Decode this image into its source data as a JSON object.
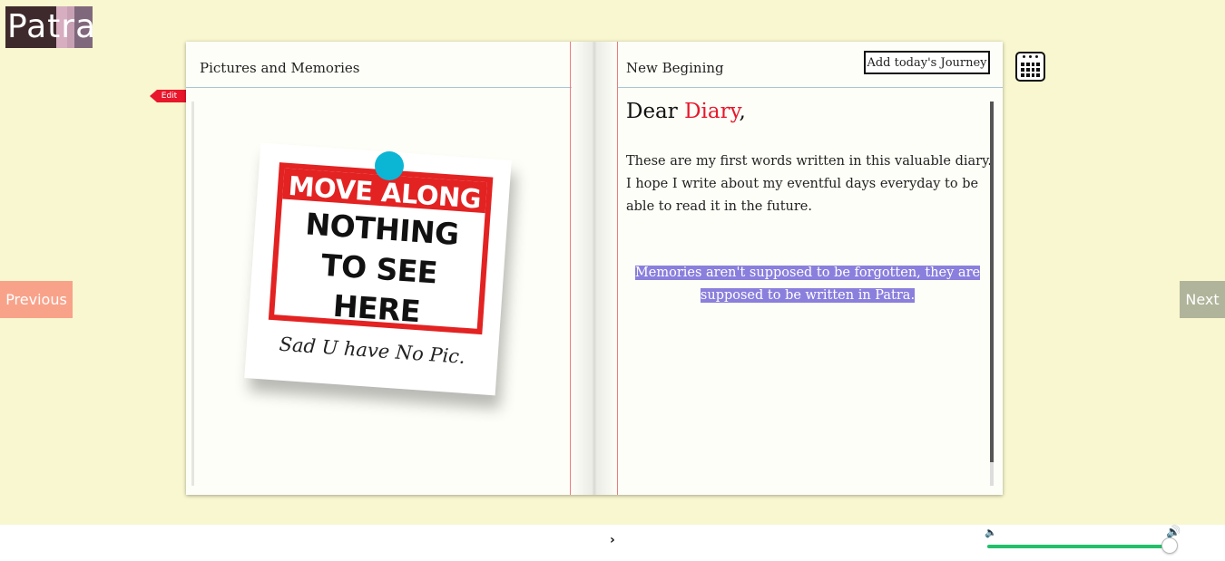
{
  "app": {
    "logo_text": "Patra",
    "logo_colors": [
      "#3e2a2c",
      "#3e2a2c",
      "#3e2a2c",
      "#3e2a2c",
      "#d6aebf",
      "#c8a0b4",
      "#80687c"
    ]
  },
  "book": {
    "left_page": {
      "title": "Pictures and Memories",
      "edit_label": "Edit",
      "photo": {
        "sign_top": "MOVE ALONG",
        "sign_lines": [
          "NOTHING",
          "TO SEE",
          "HERE"
        ],
        "caption": "Sad U have No Pic."
      }
    },
    "right_page": {
      "title": "New Begining",
      "add_journey_label": "Add today's Journey",
      "greeting_prefix": "Dear ",
      "greeting_accent": "Diary",
      "greeting_suffix": ",",
      "body": "These are my first words written in this valuable diary. I hope I write about my eventful days everyday to be able to read it in the future.",
      "quote": "Memories aren't supposed to be forgotten, they are supposed to be written in Patra."
    }
  },
  "calendar_icon": "calendar-icon",
  "nav": {
    "previous_label": "Previous",
    "next_label": "Next"
  },
  "footer": {
    "play_symbol": "›",
    "volume_low_symbol": "🔈",
    "volume_high_symbol": "🔊",
    "volume_level": 1.0
  },
  "colors": {
    "background": "#f8f7cf",
    "accent_red": "#e8172c",
    "pin": "#0bb5d4",
    "highlight": "#8a7fdc",
    "volume": "#24c069",
    "prev_button": "#f9a28a",
    "next_button": "#b0b49a"
  }
}
